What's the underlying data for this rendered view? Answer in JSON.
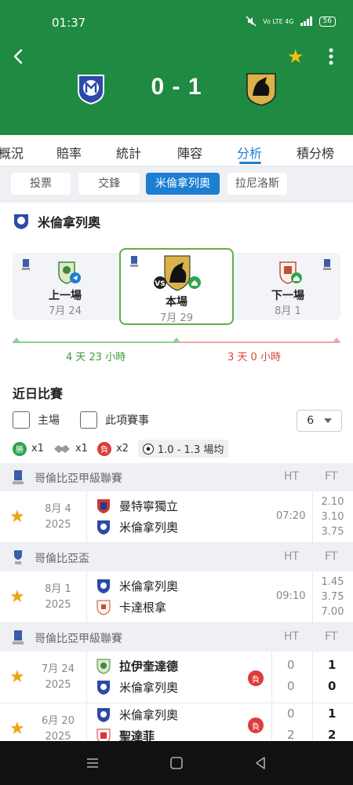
{
  "status": {
    "time": "01:37",
    "battery": "56",
    "signal_text": "Vo LTE 4G"
  },
  "match": {
    "score": "0 - 1"
  },
  "tabs": [
    {
      "label": "概況"
    },
    {
      "label": "賠率"
    },
    {
      "label": "統計"
    },
    {
      "label": "陣容"
    },
    {
      "label": "分析"
    },
    {
      "label": "積分榜"
    }
  ],
  "subtabs": [
    {
      "label": "投票"
    },
    {
      "label": "交鋒"
    },
    {
      "label": "米倫拿列奧"
    },
    {
      "label": "拉尼洛斯"
    }
  ],
  "team_section": {
    "name": "米倫拿列奧"
  },
  "fixtures": {
    "prev": {
      "label": "上一場",
      "date": "7月 24"
    },
    "current": {
      "label": "本場",
      "date": "7月 29"
    },
    "next": {
      "label": "下一場",
      "date": "8月 1"
    }
  },
  "countdown": {
    "left": "4 天 23 小時",
    "right": "3 天 0 小時"
  },
  "recent": {
    "title": "近日比賽",
    "filter_home": "主場",
    "filter_competition": "此項賽事",
    "count_selected": "6",
    "stats": {
      "win_badge": "勝",
      "win_count": "x1",
      "draw_count": "x1",
      "loss_badge": "負",
      "loss_count": "x2",
      "goals_avg": "1.0 - 1.3 場均"
    }
  },
  "groups": [
    {
      "league": "哥倫比亞甲級聯賽",
      "ht": "HT",
      "ft": "FT",
      "rows": [
        {
          "date1": "8月 4",
          "date2": "2025",
          "home": "曼特寧獨立",
          "away": "米倫拿列奧",
          "time": "07:20",
          "odds": [
            "2.10",
            "3.10",
            "3.75"
          ]
        }
      ]
    },
    {
      "league": "哥倫比亞盃",
      "ht": "HT",
      "ft": "FT",
      "rows": [
        {
          "date1": "8月 1",
          "date2": "2025",
          "home": "米倫拿列奧",
          "away": "卡達根拿",
          "time": "09:10",
          "odds": [
            "1.45",
            "3.75",
            "7.00"
          ]
        }
      ]
    },
    {
      "league": "哥倫比亞甲級聯賽",
      "ht": "HT",
      "ft": "FT",
      "rows": [
        {
          "date1": "7月 24",
          "date2": "2025",
          "home": "拉伊奎達德",
          "away": "米倫拿列奧",
          "result": "負",
          "ht_home": "0",
          "ht_away": "0",
          "ft_home": "1",
          "ft_away": "0"
        },
        {
          "date1": "6月 20",
          "date2": "2025",
          "home": "米倫拿列奧",
          "away": "聖達菲",
          "result": "負",
          "ht_home": "0",
          "ht_away": "2",
          "ft_home": "1",
          "ft_away": "2"
        }
      ]
    }
  ],
  "colors": {
    "brand_green": "#1f8a41",
    "accent_blue": "#1d7fd2",
    "loss_red": "#e03b3b",
    "win_green": "#2ea44f",
    "star": "#f2a20e"
  }
}
